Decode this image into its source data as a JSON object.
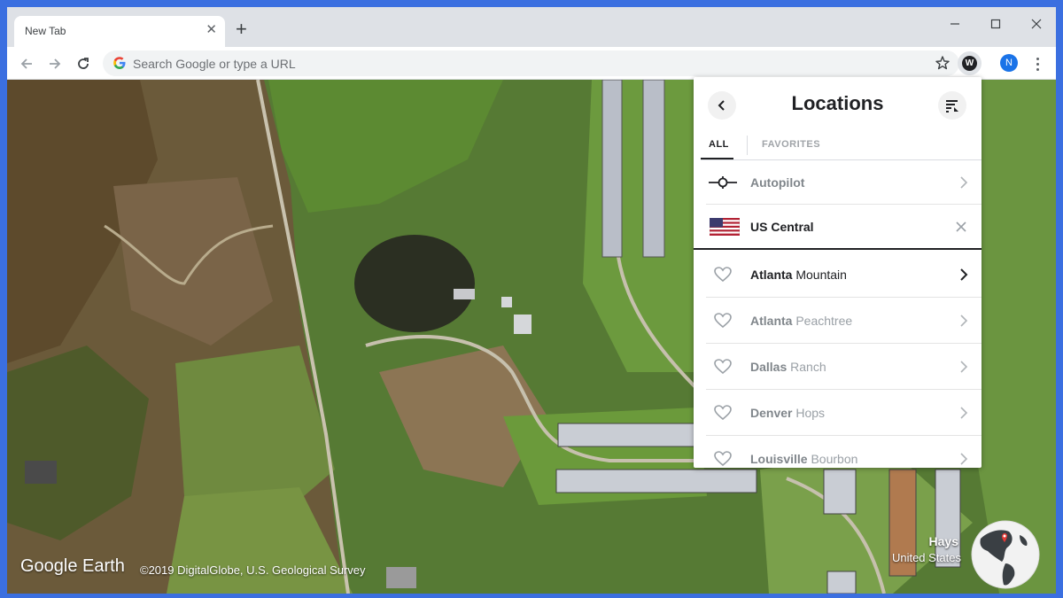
{
  "browser": {
    "tab_title": "New Tab",
    "tab_close": "✕",
    "new_tab": "+",
    "omnibox_placeholder": "Search Google or type a URL",
    "ext_badge": "W",
    "avatar_initial": "N",
    "window_minimize": "—",
    "window_maximize": "☐",
    "window_close": "✕"
  },
  "map": {
    "brand": "Google Earth",
    "copyright": "©2019 DigitalGlobe, U.S. Geological Survey",
    "place_name": "Hays",
    "place_region": "United States"
  },
  "panel": {
    "title": "Locations",
    "tabs": [
      "ALL",
      "FAVORITES"
    ],
    "autopilot_label": "Autopilot",
    "region_label": "US Central",
    "locations": [
      {
        "city": "Atlanta",
        "name": "Mountain"
      },
      {
        "city": "Atlanta",
        "name": "Peachtree"
      },
      {
        "city": "Dallas",
        "name": "Ranch"
      },
      {
        "city": "Denver",
        "name": "Hops"
      },
      {
        "city": "Louisville",
        "name": "Bourbon"
      }
    ]
  },
  "colors": {
    "accent_blue": "#1a73e8",
    "desktop_bg": "#3b6fe0"
  }
}
